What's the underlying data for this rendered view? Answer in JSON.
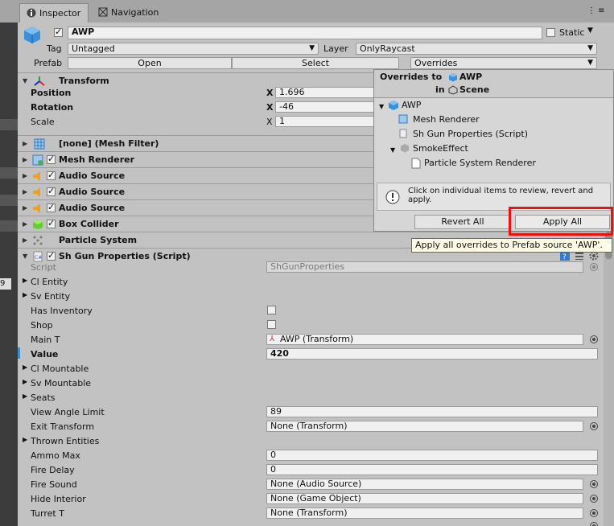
{
  "tabs": [
    {
      "label": "Inspector",
      "icon": "info-icon"
    },
    {
      "label": "Navigation",
      "icon": "navigation-icon"
    }
  ],
  "header": {
    "object_name": "AWP",
    "static_label": "Static",
    "tag_label": "Tag",
    "tag_value": "Untagged",
    "layer_label": "Layer",
    "layer_value": "OnlyRaycast",
    "prefab_label": "Prefab",
    "open_label": "Open",
    "select_label": "Select",
    "overrides_label": "Overrides"
  },
  "transform": {
    "title": "Transform",
    "position_label": "Position",
    "position_x": "1.696",
    "rotation_label": "Rotation",
    "rotation_x": "-46",
    "scale_label": "Scale",
    "scale_x": "1",
    "x_label": "X"
  },
  "components": [
    {
      "label": "[none] (Mesh Filter)"
    },
    {
      "label": "Mesh Renderer"
    },
    {
      "label": "Audio Source"
    },
    {
      "label": "Audio Source"
    },
    {
      "label": "Audio Source"
    },
    {
      "label": "Box Collider"
    },
    {
      "label": "Particle System"
    },
    {
      "label": "Sh Gun Properties (Script)"
    }
  ],
  "script_fields": {
    "script_label": "Script",
    "script_value": "ShGunProperties",
    "cl_entity": "Cl Entity",
    "sv_entity": "Sv Entity",
    "has_inventory": "Has Inventory",
    "shop": "Shop",
    "main_t": "Main T",
    "main_t_value": "AWP (Transform)",
    "value_label": "Value",
    "value_value": "420",
    "cl_mountable": "Cl Mountable",
    "sv_mountable": "Sv Mountable",
    "seats": "Seats",
    "view_angle_limit": "View Angle Limit",
    "view_angle_limit_value": "89",
    "exit_transform": "Exit Transform",
    "exit_transform_value": "None (Transform)",
    "thrown_entities": "Thrown Entities",
    "ammo_max": "Ammo Max",
    "ammo_max_value": "0",
    "fire_delay": "Fire Delay",
    "fire_delay_value": "0",
    "fire_sound": "Fire Sound",
    "fire_sound_value": "None (Audio Source)",
    "hide_interior": "Hide Interior",
    "hide_interior_value": "None (Game Object)",
    "turret_t": "Turret T",
    "turret_t_value": "None (Transform)"
  },
  "popup": {
    "title": "Overrides to",
    "target": "AWP",
    "in_label": "in",
    "scene_label": "Scene",
    "tree": [
      "AWP",
      "Mesh Renderer",
      "Sh Gun Properties (Script)",
      "SmokeEffect",
      "Particle System Renderer"
    ],
    "info": "Click on individual items to review, revert and apply.",
    "revert_all": "Revert All",
    "apply_all": "Apply All"
  },
  "tooltip": "Apply all overrides to Prefab source 'AWP'.",
  "left_fragment": "9",
  "colors": {
    "highlight": "#e11111",
    "tooltip_bg": "#fffde6"
  }
}
